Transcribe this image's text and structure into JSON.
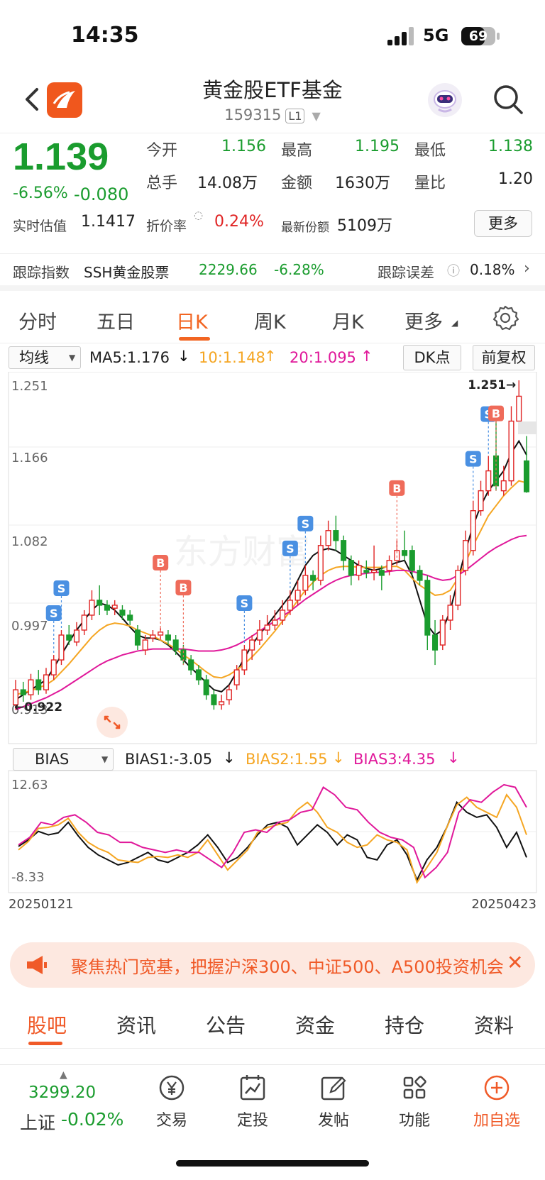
{
  "status": {
    "time": "14:35",
    "network": "5G",
    "battery": "69",
    "battery_level": 0.69
  },
  "header": {
    "title": "黄金股ETF基金",
    "code": "159315",
    "level": "L1"
  },
  "quote": {
    "price": "1.139",
    "change_pct": "-6.56%",
    "change": "-0.080",
    "open_label": "今开",
    "open": "1.156",
    "high_label": "最高",
    "high": "1.195",
    "low_label": "最低",
    "low": "1.138",
    "volume_label": "总手",
    "volume": "14.08万",
    "amount_label": "金额",
    "amount": "1630万",
    "ratio_label": "量比",
    "ratio": "1.20",
    "iopv_label": "实时估值",
    "iopv": "1.1417",
    "premium_label": "折价率",
    "premium": "0.24%",
    "shares_label": "最新份额",
    "shares": "5109万",
    "more_label": "更多"
  },
  "tracking": {
    "index_label": "跟踪指数",
    "index_name": "SSH黄金股票",
    "index_value": "2229.66",
    "index_change": "-6.28%",
    "error_label": "跟踪误差",
    "error_value": "0.18%"
  },
  "period_tabs": [
    "分时",
    "五日",
    "日K",
    "周K",
    "月K",
    "更多"
  ],
  "active_tab": "日K",
  "kline_bar": {
    "indicator": "均线",
    "ma5": "MA5:1.176",
    "ma10": "10:1.148",
    "ma20": "20:1.095",
    "dk_label": "DK点",
    "adjust_label": "前复权"
  },
  "bias_bar": {
    "indicator": "BIAS",
    "bias1": "BIAS1:-3.05",
    "bias2": "BIAS2:1.55",
    "bias3": "BIAS3:4.35"
  },
  "chart_data": [
    {
      "type": "candlestick",
      "title": "",
      "y_ticks": [
        "1.251",
        "1.166",
        "1.082",
        "0.997",
        "0.913"
      ],
      "ylim": [
        0.913,
        1.251
      ],
      "annotations": {
        "max": "1.251",
        "min": "0.922"
      },
      "x_range": [
        "20250121",
        "20250423"
      ],
      "candles": [
        [
          0.925,
          0.94,
          0.95,
          0.92
        ],
        [
          0.94,
          0.935,
          0.948,
          0.928
        ],
        [
          0.935,
          0.95,
          0.956,
          0.93
        ],
        [
          0.95,
          0.94,
          0.96,
          0.935
        ],
        [
          0.94,
          0.955,
          0.962,
          0.936
        ],
        [
          0.955,
          0.97,
          0.975,
          0.95
        ],
        [
          0.97,
          0.995,
          1.0,
          0.965
        ],
        [
          0.995,
          0.99,
          1.005,
          0.985
        ],
        [
          0.988,
          1.0,
          1.008,
          0.984
        ],
        [
          1.0,
          1.015,
          1.02,
          0.995
        ],
        [
          1.015,
          1.03,
          1.04,
          1.01
        ],
        [
          1.03,
          1.025,
          1.045,
          1.015
        ],
        [
          1.025,
          1.02,
          1.03,
          1.015
        ],
        [
          1.022,
          1.025,
          1.03,
          1.015
        ],
        [
          1.02,
          1.015,
          1.025,
          1.01
        ],
        [
          1.015,
          1.01,
          1.02,
          1.005
        ],
        [
          1.0,
          0.985,
          1.005,
          0.98
        ],
        [
          0.98,
          0.99,
          0.995,
          0.975
        ],
        [
          0.992,
          0.995,
          1.0,
          0.988
        ],
        [
          0.995,
          0.998,
          1.002,
          0.99
        ],
        [
          0.995,
          0.99,
          1.0,
          0.985
        ],
        [
          0.99,
          0.98,
          0.995,
          0.975
        ],
        [
          0.98,
          0.97,
          0.985,
          0.965
        ],
        [
          0.97,
          0.96,
          0.975,
          0.955
        ],
        [
          0.96,
          0.95,
          0.965,
          0.945
        ],
        [
          0.95,
          0.935,
          0.955,
          0.93
        ],
        [
          0.935,
          0.925,
          0.94,
          0.92
        ],
        [
          0.925,
          0.928,
          0.935,
          0.92
        ],
        [
          0.93,
          0.94,
          0.945,
          0.925
        ],
        [
          0.945,
          0.96,
          0.965,
          0.94
        ],
        [
          0.96,
          0.98,
          0.985,
          0.955
        ],
        [
          0.98,
          0.99,
          0.995,
          0.97
        ],
        [
          0.99,
          1.0,
          1.01,
          0.985
        ],
        [
          1.0,
          1.005,
          1.015,
          0.995
        ],
        [
          1.005,
          1.01,
          1.02,
          1.0
        ],
        [
          1.01,
          1.02,
          1.03,
          1.005
        ],
        [
          1.02,
          1.03,
          1.04,
          1.015
        ],
        [
          1.03,
          1.04,
          1.05,
          1.025
        ],
        [
          1.04,
          1.055,
          1.065,
          1.035
        ],
        [
          1.055,
          1.05,
          1.06,
          1.04
        ],
        [
          1.05,
          1.085,
          1.095,
          1.045
        ],
        [
          1.085,
          1.1,
          1.11,
          1.08
        ],
        [
          1.1,
          1.09,
          1.115,
          1.08
        ],
        [
          1.09,
          1.07,
          1.095,
          1.06
        ],
        [
          1.07,
          1.055,
          1.075,
          1.045
        ],
        [
          1.055,
          1.065,
          1.07,
          1.05
        ],
        [
          1.06,
          1.058,
          1.07,
          1.052
        ],
        [
          1.058,
          1.06,
          1.085,
          1.05
        ],
        [
          1.06,
          1.055,
          1.065,
          1.04
        ],
        [
          1.06,
          1.07,
          1.075,
          1.055
        ],
        [
          1.07,
          1.08,
          1.09,
          1.065
        ],
        [
          1.08,
          1.075,
          1.1,
          1.07
        ],
        [
          1.08,
          1.06,
          1.085,
          1.055
        ],
        [
          1.06,
          1.05,
          1.065,
          1.045
        ],
        [
          1.05,
          0.995,
          1.055,
          0.98
        ],
        [
          0.995,
          0.98,
          1.01,
          0.965
        ],
        [
          0.985,
          1.01,
          1.015,
          0.98
        ],
        [
          1.01,
          1.025,
          1.035,
          1.0
        ],
        [
          1.025,
          1.06,
          1.065,
          1.02
        ],
        [
          1.06,
          1.09,
          1.1,
          1.055
        ],
        [
          1.08,
          1.12,
          1.13,
          1.075
        ],
        [
          1.12,
          1.14,
          1.15,
          1.115
        ],
        [
          1.14,
          1.16,
          1.175,
          1.135
        ],
        [
          1.175,
          1.145,
          1.215,
          1.14
        ],
        [
          1.14,
          1.15,
          1.165,
          1.135
        ],
        [
          1.15,
          1.21,
          1.225,
          1.145
        ],
        [
          1.21,
          1.235,
          1.251,
          1.2
        ],
        [
          1.17,
          1.139,
          1.195,
          1.138
        ]
      ],
      "series": [
        {
          "name": "MA5",
          "color": "#111111",
          "values": [
            0.93,
            0.935,
            0.94,
            0.945,
            0.95,
            0.962,
            0.975,
            0.988,
            1.0,
            1.01,
            1.02,
            1.027,
            1.025,
            1.02,
            1.012,
            1.003,
            0.995,
            0.992,
            0.992,
            0.99,
            0.985,
            0.978,
            0.97,
            0.962,
            0.955,
            0.947,
            0.94,
            0.938,
            0.945,
            0.958,
            0.972,
            0.985,
            0.996,
            1.005,
            1.015,
            1.025,
            1.035,
            1.05,
            1.065,
            1.075,
            1.08,
            1.082,
            1.08,
            1.075,
            1.07,
            1.065,
            1.062,
            1.06,
            1.062,
            1.065,
            1.068,
            1.07,
            1.055,
            1.03,
            1.005,
            0.995,
            1.0,
            1.02,
            1.05,
            1.08,
            1.105,
            1.125,
            1.14,
            1.15,
            1.16,
            1.178,
            1.19,
            1.176
          ]
        },
        {
          "name": "MA10",
          "color": "#f5a623",
          "values": [
            0.935,
            0.937,
            0.939,
            0.942,
            0.945,
            0.95,
            0.958,
            0.966,
            0.975,
            0.984,
            0.993,
            1.0,
            1.005,
            1.007,
            1.006,
            1.004,
            1.0,
            0.997,
            0.994,
            0.99,
            0.986,
            0.981,
            0.975,
            0.97,
            0.964,
            0.958,
            0.953,
            0.952,
            0.955,
            0.96,
            0.966,
            0.973,
            0.981,
            0.99,
            0.999,
            1.009,
            1.019,
            1.03,
            1.04,
            1.048,
            1.055,
            1.06,
            1.063,
            1.064,
            1.064,
            1.063,
            1.063,
            1.063,
            1.063,
            1.064,
            1.064,
            1.06,
            1.052,
            1.045,
            1.04,
            1.035,
            1.036,
            1.04,
            1.052,
            1.068,
            1.085,
            1.1,
            1.115,
            1.125,
            1.135,
            1.143,
            1.15,
            1.148
          ]
        },
        {
          "name": "MA20",
          "color": "#e0189a",
          "values": [
            0.92,
            0.923,
            0.926,
            0.929,
            0.932,
            0.936,
            0.94,
            0.945,
            0.95,
            0.955,
            0.96,
            0.965,
            0.969,
            0.972,
            0.975,
            0.977,
            0.979,
            0.98,
            0.981,
            0.981,
            0.981,
            0.981,
            0.981,
            0.98,
            0.979,
            0.979,
            0.979,
            0.98,
            0.982,
            0.985,
            0.989,
            0.994,
            0.999,
            1.004,
            1.009,
            1.014,
            1.019,
            1.025,
            1.031,
            1.036,
            1.041,
            1.046,
            1.05,
            1.053,
            1.055,
            1.056,
            1.057,
            1.058,
            1.058,
            1.059,
            1.06,
            1.06,
            1.059,
            1.057,
            1.055,
            1.052,
            1.05,
            1.051,
            1.055,
            1.06,
            1.066,
            1.072,
            1.078,
            1.083,
            1.087,
            1.091,
            1.094,
            1.095
          ]
        }
      ],
      "signals": [
        {
          "label": "S",
          "index": 5
        },
        {
          "label": "S",
          "index": 6
        },
        {
          "label": "B",
          "index": 19
        },
        {
          "label": "B",
          "index": 22
        },
        {
          "label": "S",
          "index": 30
        },
        {
          "label": "S",
          "index": 36
        },
        {
          "label": "S",
          "index": 38
        },
        {
          "label": "B",
          "index": 50
        },
        {
          "label": "S",
          "index": 60
        },
        {
          "label": "S",
          "index": 62
        },
        {
          "label": "B",
          "index": 63
        }
      ]
    },
    {
      "type": "line",
      "title": "",
      "y_ticks": [
        "12.63",
        "-8.33"
      ],
      "ylim": [
        -8.33,
        12.63
      ],
      "x_labels": [
        "20250121",
        "20250423"
      ],
      "series": [
        {
          "name": "BIAS1",
          "color": "#111111",
          "values": [
            -0.8,
            0.5,
            2.2,
            1.5,
            1.9,
            4.0,
            1.3,
            -1.0,
            -2.5,
            -3.5,
            -4.5,
            -4.0,
            -3.0,
            -2.0,
            -3.5,
            -4.0,
            -3.0,
            -2.0,
            -0.5,
            1.5,
            -1.0,
            -4.0,
            -3.0,
            -1.0,
            1.5,
            3.5,
            4.0,
            3.0,
            -0.5,
            1.5,
            3.5,
            2.0,
            -0.5,
            1.5,
            0.5,
            -3.0,
            -3.5,
            -0.5,
            0.5,
            -2.5,
            -7.5,
            -3.5,
            -1.0,
            3.0,
            8.0,
            6.0,
            5.0,
            5.5,
            3.0,
            -1.0,
            2.0,
            -3.0
          ]
        },
        {
          "name": "BIAS2",
          "color": "#f5a623",
          "values": [
            -1.5,
            0.2,
            2.8,
            3.0,
            3.5,
            4.8,
            2.0,
            0.0,
            -1.2,
            -2.0,
            -3.5,
            -3.8,
            -4.0,
            -3.0,
            -2.8,
            -3.0,
            -2.5,
            -3.0,
            -2.0,
            0.5,
            -2.5,
            -5.5,
            -3.5,
            -1.5,
            2.0,
            3.0,
            3.5,
            4.0,
            6.5,
            8.0,
            6.0,
            3.0,
            2.0,
            0.0,
            -1.0,
            -0.5,
            1.5,
            0.5,
            0.0,
            -1.5,
            -8.0,
            -5.0,
            -2.0,
            3.0,
            7.5,
            9.0,
            7.0,
            6.0,
            5.0,
            9.5,
            7.0,
            1.5
          ]
        },
        {
          "name": "BIAS3",
          "color": "#e0189a",
          "values": [
            -0.5,
            1.0,
            4.0,
            3.5,
            5.0,
            5.5,
            4.0,
            2.0,
            1.5,
            0.0,
            0.0,
            -1.0,
            -1.5,
            -2.0,
            -1.5,
            -2.0,
            -2.0,
            -3.5,
            -5.0,
            -2.0,
            2.0,
            2.5,
            2.0,
            4.0,
            4.5,
            6.0,
            6.5,
            11.0,
            9.5,
            7.0,
            6.5,
            4.0,
            2.0,
            1.0,
            0.5,
            -1.0,
            -7.0,
            -5.0,
            -2.0,
            6.0,
            8.5,
            8.0,
            10.0,
            11.5,
            11.0,
            7.0
          ]
        }
      ]
    }
  ],
  "banner": {
    "text": "聚焦热门宽基，把握沪深300、中证500、A500投资机会"
  },
  "content_tabs": [
    "股吧",
    "资讯",
    "公告",
    "资金",
    "持仓",
    "资料"
  ],
  "active_content_tab": "股吧",
  "bottom": {
    "index_value": "3299.20",
    "index_name": "上证",
    "index_change": "-0.02%",
    "items": [
      "交易",
      "定投",
      "发帖",
      "功能",
      "加自选"
    ]
  }
}
